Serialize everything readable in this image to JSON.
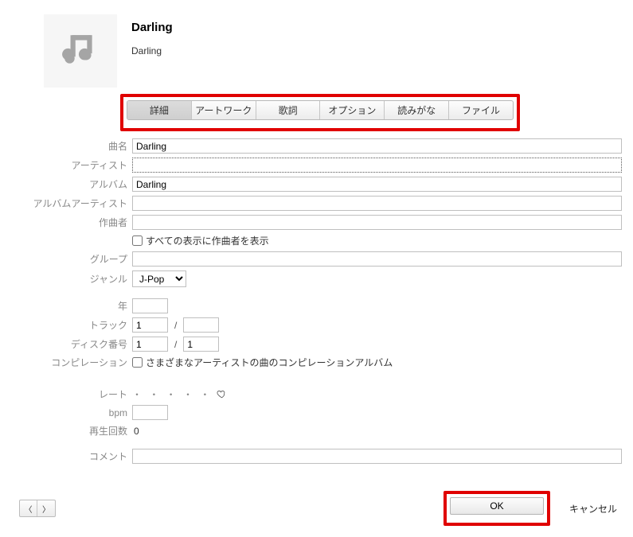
{
  "header": {
    "title": "Darling",
    "subtitle": "Darling"
  },
  "tabs": [
    {
      "label": "詳細",
      "active": true
    },
    {
      "label": "アートワーク",
      "active": false
    },
    {
      "label": "歌詞",
      "active": false
    },
    {
      "label": "オプション",
      "active": false
    },
    {
      "label": "読みがな",
      "active": false
    },
    {
      "label": "ファイル",
      "active": false
    }
  ],
  "labels": {
    "song": "曲名",
    "artist": "アーティスト",
    "album": "アルバム",
    "album_artist": "アルバムアーティスト",
    "composer": "作曲者",
    "show_composer": "すべての表示に作曲者を表示",
    "group": "グループ",
    "genre": "ジャンル",
    "year": "年",
    "track": "トラック",
    "disc": "ディスク番号",
    "compilation": "コンピレーション",
    "compilation_text": "さまざまなアーティストの曲のコンピレーションアルバム",
    "rate": "レート",
    "bpm": "bpm",
    "plays": "再生回数",
    "comment": "コメント"
  },
  "values": {
    "song": "Darling",
    "artist": "",
    "album": "Darling",
    "album_artist": "",
    "composer": "",
    "show_composer": false,
    "group": "",
    "genre": "J-Pop",
    "year": "",
    "track_num": "1",
    "track_total": "",
    "disc_num": "1",
    "disc_total": "1",
    "compilation": false,
    "bpm": "",
    "plays": "0",
    "comment": ""
  },
  "rating_dots": "・ ・ ・ ・ ・",
  "footer": {
    "ok": "OK",
    "cancel": "キャンセル"
  },
  "colors": {
    "highlight": "#e00000"
  }
}
